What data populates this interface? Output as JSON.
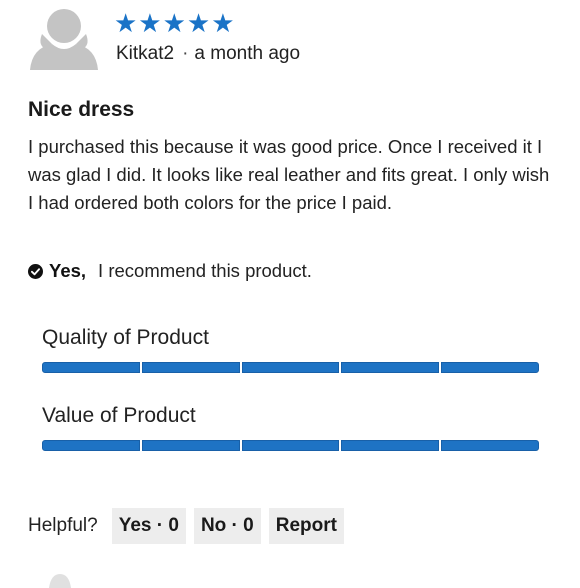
{
  "review": {
    "rating_stars": "★★★★★",
    "rating_value": 5,
    "rating_max": 5,
    "author": "Kitkat2",
    "separator": "·",
    "time": "a month ago",
    "title": "Nice dress",
    "body": "I purchased this because it was good price. Once I received it I was glad I did. It looks like real leather and fits great. I only wish I had ordered both colors for the price I paid.",
    "recommend": {
      "yes_label": "Yes,",
      "text": "I recommend this product."
    },
    "ratings": [
      {
        "label": "Quality of Product",
        "value": 5,
        "max": 5
      },
      {
        "label": "Value of Product",
        "value": 5,
        "max": 5
      }
    ]
  },
  "helpful": {
    "label": "Helpful?",
    "yes_button": "Yes · 0",
    "no_button": "No · 0",
    "report_button": "Report"
  },
  "colors": {
    "star": "#1a73c7",
    "bar": "#1e73c4",
    "button_bg": "#ededed",
    "avatar": "#c4c4c4"
  },
  "icons": {
    "avatar": "user-silhouette-icon",
    "recommend": "check-circle-icon"
  }
}
